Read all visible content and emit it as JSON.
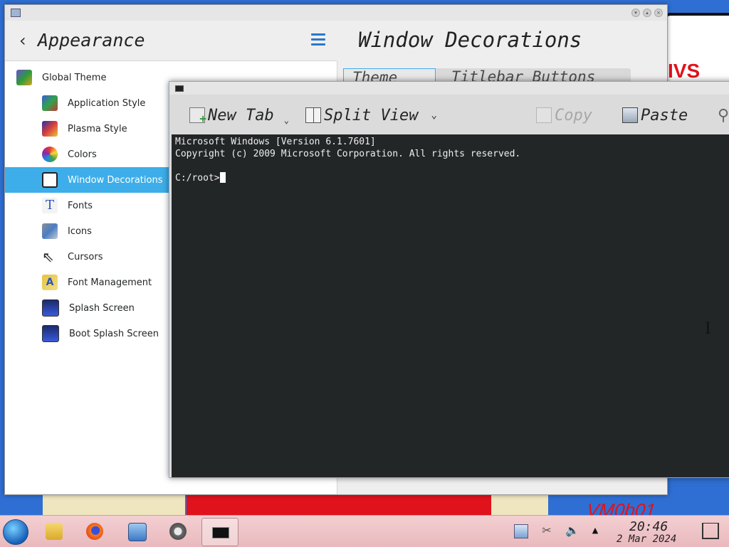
{
  "colors": {
    "accent": "#3daee9",
    "terminal_bg": "#232627",
    "terminal_fg": "#eeeeee",
    "wallpaper_red_text": "#e0121c"
  },
  "wallpaper": {
    "sign_text": "IVS",
    "vm_label": "VM0b01"
  },
  "settings": {
    "sidebar_title": "Appearance",
    "page_title": "Window Decorations",
    "tabs": [
      {
        "label": "Theme",
        "active": true
      },
      {
        "label": "Titlebar Buttons",
        "active": false
      }
    ],
    "items": [
      {
        "label": "Global Theme",
        "icon": "global-theme-icon",
        "selected": false
      },
      {
        "label": "Application Style",
        "icon": "application-style-icon",
        "selected": false
      },
      {
        "label": "Plasma Style",
        "icon": "plasma-style-icon",
        "selected": false
      },
      {
        "label": "Colors",
        "icon": "colors-icon",
        "selected": false
      },
      {
        "label": "Window Decorations",
        "icon": "window-decorations-icon",
        "selected": true
      },
      {
        "label": "Fonts",
        "icon": "fonts-icon",
        "selected": false
      },
      {
        "label": "Icons",
        "icon": "icons-icon",
        "selected": false
      },
      {
        "label": "Cursors",
        "icon": "cursor-icon",
        "selected": false
      },
      {
        "label": "Font Management",
        "icon": "font-management-icon",
        "selected": false
      },
      {
        "label": "Splash Screen",
        "icon": "splash-screen-icon",
        "selected": false
      },
      {
        "label": "Boot Splash Screen",
        "icon": "boot-splash-screen-icon",
        "selected": false
      }
    ]
  },
  "terminal": {
    "toolbar": {
      "new_tab": "New Tab",
      "split_view": "Split View",
      "copy": "Copy",
      "paste": "Paste"
    },
    "lines": [
      "Microsoft Windows [Version 6.1.7601]",
      "Copyright (c) 2009 Microsoft Corporation. All rights reserved.",
      "",
      "C:/root>"
    ]
  },
  "taskbar": {
    "time": "20:46",
    "date": "2 Mar 2024",
    "launchers": [
      "file-manager-icon",
      "firefox-icon",
      "system-settings-icon",
      "compass-icon"
    ],
    "tray": [
      "clipboard-icon",
      "scissors-icon",
      "volume-icon",
      "expand-tray-icon"
    ]
  }
}
